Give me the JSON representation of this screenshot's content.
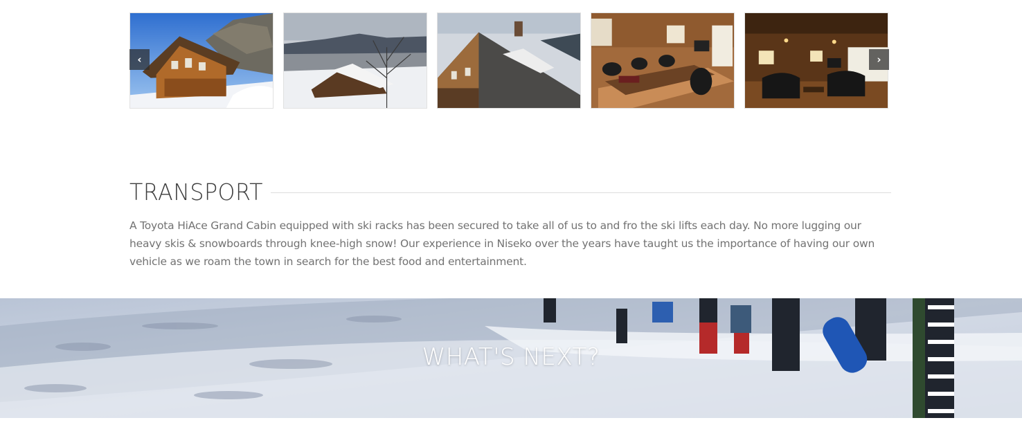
{
  "gallery": {
    "images": [
      {
        "name": "cabin-exterior-blue-sky"
      },
      {
        "name": "cabin-snowy-landscape"
      },
      {
        "name": "cabin-roof-chimney"
      },
      {
        "name": "dining-room-interior"
      },
      {
        "name": "living-room-interior"
      }
    ],
    "prev_icon": "‹",
    "next_icon": "›"
  },
  "transport": {
    "title": "TRANSPORT",
    "body": "A Toyota HiAce Grand Cabin equipped with ski racks has been secured to take all of us to and fro the ski lifts each day. No more lugging our heavy skis & snowboards through knee-high snow! Our experience in Niseko over the years have taught us the importance of having our own vehicle as we roam the town in search for the best food and entertainment."
  },
  "next_section": {
    "title": "WHAT'S NEXT?"
  },
  "colors": {
    "heading": "#3d3d3d",
    "body_text": "#727272",
    "rule": "#dcdcdc",
    "arrow_bg": "#2d2d2d"
  }
}
